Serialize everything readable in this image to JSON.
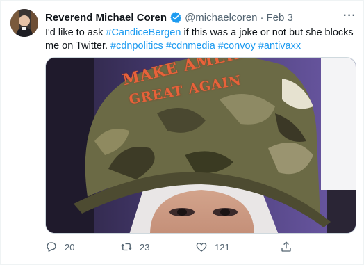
{
  "tweet": {
    "author": {
      "display_name": "Reverend Michael Coren",
      "handle": "@michaelcoren",
      "verified": true,
      "avatar_icon": "profile-photo"
    },
    "separator": "·",
    "timestamp": "Feb 3",
    "more_icon": "more-icon",
    "more_glyph": "···",
    "text": {
      "part1": "I'd like to ask ",
      "tag1": "#CandiceBergen",
      "part2": " if this was a joke or not but she blocks me on Twitter. ",
      "tag2": "#cdnpolitics",
      "tag3": "#cdnmedia",
      "tag4": "#convoy",
      "tag5": "#antivaxx"
    },
    "media": {
      "hat_line1": "MAKE AMERICA",
      "hat_line2": "GREAT AGAIN"
    },
    "actions": {
      "reply_count": "20",
      "retweet_count": "23",
      "like_count": "121"
    }
  },
  "colors": {
    "link": "#1d9bf0",
    "secondary_text": "#536471",
    "hat_text": "#e8623a"
  }
}
